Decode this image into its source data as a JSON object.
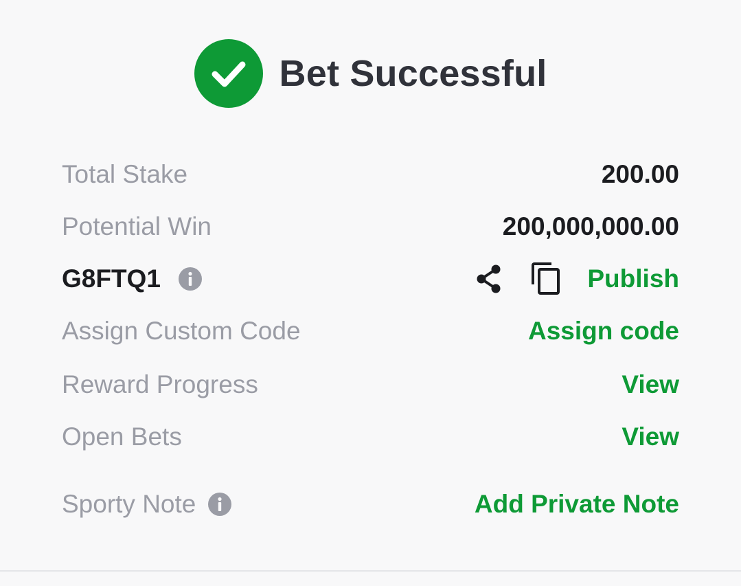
{
  "header": {
    "title": "Bet Successful",
    "icon": "check-circle-icon",
    "icon_color": "#0e9a36"
  },
  "rows": {
    "total_stake": {
      "label": "Total Stake",
      "value": "200.00"
    },
    "potential_win": {
      "label": "Potential Win",
      "value": "200,000,000.00"
    },
    "booking_code": {
      "code": "G8FTQ1",
      "info_icon": "info-icon",
      "share_icon": "share-icon",
      "copy_icon": "copy-icon",
      "publish_label": "Publish"
    },
    "custom_code": {
      "label": "Assign Custom Code",
      "action": "Assign code"
    },
    "reward_progress": {
      "label": "Reward Progress",
      "action": "View"
    },
    "open_bets": {
      "label": "Open Bets",
      "action": "View"
    },
    "sporty_note": {
      "label": "Sporty Note",
      "info_icon": "info-icon",
      "action": "Add Private Note"
    }
  },
  "colors": {
    "accent": "#0e9a36",
    "label": "#9a9ca5",
    "text": "#1b1c20",
    "background": "#f8f8f9"
  }
}
